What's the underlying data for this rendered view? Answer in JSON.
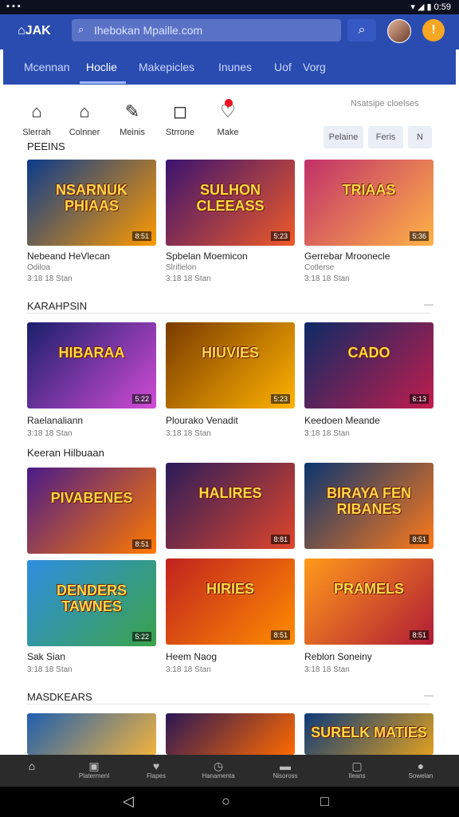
{
  "status": {
    "left": "▪ ▪ ▪",
    "right": "▾ ◢ ▮ 0:59"
  },
  "header": {
    "logo": "⌂JAK",
    "search_placeholder": "Ihebokan Mpaille.com",
    "coin": "!"
  },
  "tabs": [
    "Mcennan",
    "Hoclie",
    "Makepicles",
    "Inunes",
    "Uof",
    "Vorg"
  ],
  "quick": [
    {
      "icon": "home-icon",
      "glyph": "⌂",
      "label": "Slerrah"
    },
    {
      "icon": "store-icon",
      "glyph": "⌂",
      "label": "Colnner"
    },
    {
      "icon": "media-icon",
      "glyph": "✎",
      "label": "Meinis"
    },
    {
      "icon": "screen-icon",
      "glyph": "◻",
      "label": "Strrone"
    },
    {
      "icon": "heart-icon",
      "glyph": "♡",
      "label": "Make"
    }
  ],
  "feature_link": "Nsatsipe cloelses",
  "chips": [
    "Pelaine",
    "Feris",
    "N"
  ],
  "sections": [
    {
      "title": "PEEINS"
    },
    {
      "title": "KARAHPSIN"
    },
    {
      "title": "Keeran Hilbuaan"
    },
    {
      "title": "MASDKEARS"
    }
  ],
  "cards": [
    {
      "title": "NSARNUK PHIAAS",
      "length": "8:51",
      "caption": "Nebeand HeVlecan",
      "sub1": "Odiloa",
      "sub2": "3:18 18 Stan",
      "colors": [
        "#0b3b8c",
        "#ff9a00"
      ]
    },
    {
      "title": "SULHON CLEEASS",
      "length": "5:23",
      "caption": "Spbelan Moemicon",
      "sub1": "Slrifielon",
      "sub2": "3:18 18 Stan",
      "colors": [
        "#3a1370",
        "#f05a28"
      ]
    },
    {
      "title": "TRIAAS",
      "length": "5:36",
      "caption": "Gerrebar Mroonecle",
      "sub1": "Cotlerse",
      "sub2": "3:18 18 Stan",
      "colors": [
        "#c0306a",
        "#ffb347"
      ]
    },
    {
      "title": "HIBARAA",
      "length": "5:22",
      "caption": "Raelanaliann",
      "sub2": "3:18 18 Stan",
      "colors": [
        "#1a1f6b",
        "#d24cd6"
      ]
    },
    {
      "title": "HIUVIES",
      "length": "5:23",
      "caption": "Plourako Venadit",
      "sub2": "3:18 18 Stan",
      "colors": [
        "#7a3b00",
        "#ffb300"
      ]
    },
    {
      "title": "CADO",
      "length": "6:13",
      "caption": "Keedoen Meande",
      "sub2": "3:18 18 Stan",
      "colors": [
        "#0d2a66",
        "#c11d4d"
      ]
    },
    {
      "title": "PIVABENES",
      "length": "8:51",
      "caption": "",
      "sub2": "",
      "colors": [
        "#4b1a8a",
        "#ff7a00"
      ]
    },
    {
      "title": "HALIRES",
      "length": "8:81",
      "caption": "",
      "sub2": "",
      "colors": [
        "#2a1c5a",
        "#e0452b"
      ]
    },
    {
      "title": "BIRAYA FEN RIBANES",
      "length": "8:51",
      "caption": "",
      "sub2": "",
      "colors": [
        "#0a3570",
        "#ff7a1a"
      ]
    },
    {
      "title": "DENDERS TAWNES",
      "length": "5:22",
      "caption": "Sak Sian",
      "sub2": "3:18 18 Stan",
      "colors": [
        "#2f8de0",
        "#3aa34a"
      ]
    },
    {
      "title": "HIRIES",
      "length": "8:51",
      "caption": "Heem Naog",
      "sub2": "3:18 18 Stan",
      "colors": [
        "#c0231f",
        "#ff8c00"
      ]
    },
    {
      "title": "PRAMELS",
      "length": "8:51",
      "caption": "Reblon Soneiny",
      "sub2": "3:18 18 Stan",
      "colors": [
        "#ff9a1a",
        "#b01b36"
      ]
    },
    {
      "title": "",
      "length": "",
      "caption": "",
      "sub2": "",
      "colors": [
        "#1f5fb0",
        "#f2b33d"
      ]
    },
    {
      "title": "",
      "length": "",
      "caption": "",
      "sub2": "",
      "colors": [
        "#2b1755",
        "#ff6a00"
      ]
    },
    {
      "title": "SURELK MATIES",
      "length": "",
      "caption": "",
      "sub2": "",
      "colors": [
        "#0e3a78",
        "#e0a020"
      ]
    }
  ],
  "bottom_nav": [
    {
      "icon": "home-icon",
      "glyph": "⌂",
      "label": ""
    },
    {
      "icon": "store-icon",
      "glyph": "▣",
      "label": "Platermenl"
    },
    {
      "icon": "heart-icon",
      "glyph": "♥",
      "label": "Flapes"
    },
    {
      "icon": "clock-icon",
      "glyph": "◷",
      "label": "Hanamenta"
    },
    {
      "icon": "folder-icon",
      "glyph": "▬",
      "label": "Nisoross"
    },
    {
      "icon": "chat-icon",
      "glyph": "▢",
      "label": "Ileans"
    },
    {
      "icon": "user-icon",
      "glyph": "●",
      "label": "Sowelan"
    }
  ],
  "sysnav": {
    "back": "◁",
    "home": "○",
    "recent": "□"
  }
}
